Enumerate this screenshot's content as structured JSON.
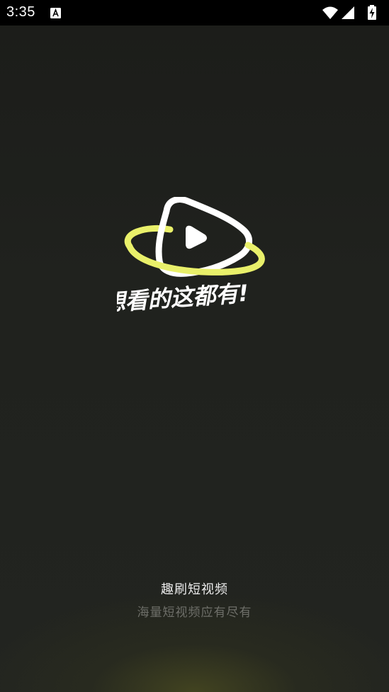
{
  "status_bar": {
    "time": "3:35",
    "icons": [
      "text-a-icon",
      "wifi-icon",
      "signal-icon",
      "battery-charging-icon"
    ]
  },
  "splash": {
    "logo_icon": "play-ring-logo-icon",
    "tagline": "想看的这都有!",
    "app_name": "趣刷短视频",
    "slogan": "海量短视频应有尽有"
  },
  "colors": {
    "background": "#1f201d",
    "accent": "#e9f06a",
    "status_bar": "#000000"
  }
}
